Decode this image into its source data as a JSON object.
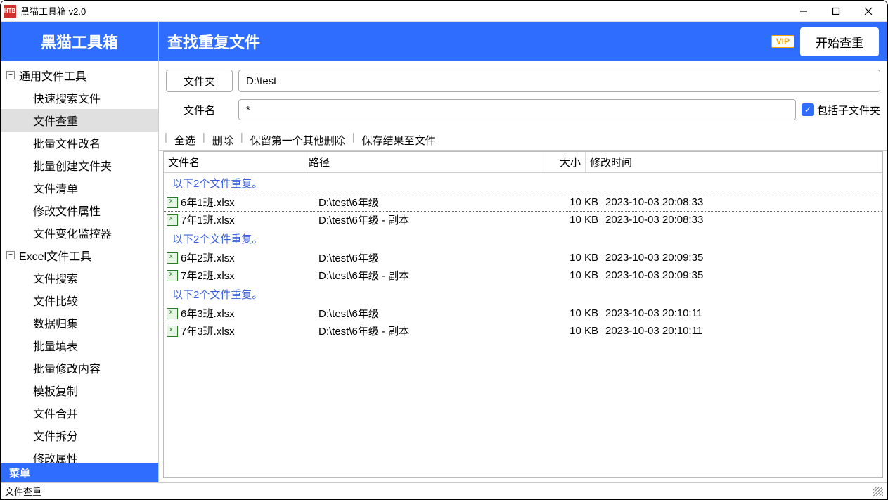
{
  "window": {
    "title": "黑猫工具箱 v2.0",
    "logo_text": "HTB"
  },
  "sidebar": {
    "brand": "黑猫工具箱",
    "footer": "菜单",
    "groups": [
      {
        "label": "通用文件工具",
        "expanded": true,
        "items": [
          "快速搜索文件",
          "文件查重",
          "批量文件改名",
          "批量创建文件夹",
          "文件清单",
          "修改文件属性",
          "文件变化监控器"
        ]
      },
      {
        "label": "Excel文件工具",
        "expanded": true,
        "items": [
          "文件搜索",
          "文件比较",
          "数据归集",
          "批量填表",
          "批量修改内容",
          "模板复制",
          "文件合并",
          "文件拆分",
          "修改属性"
        ]
      }
    ],
    "active_item": "文件查重"
  },
  "header": {
    "title": "查找重复文件",
    "vip": "VIP",
    "start": "开始查重"
  },
  "form": {
    "folder_btn": "文件夹",
    "folder_value": "D:\\test",
    "filename_label": "文件名",
    "pattern_value": "*",
    "include_sub_label": "包括子文件夹",
    "include_sub_checked": true
  },
  "toolbar": {
    "select_all": "全选",
    "delete": "删除",
    "keep_first": "保留第一个其他删除",
    "save_result": "保存结果至文件"
  },
  "columns": {
    "name": "文件名",
    "path": "路径",
    "size": "大小",
    "date": "修改时间"
  },
  "group_prefix": "以下2个文件重复。",
  "groups": [
    {
      "files": [
        {
          "name": "6年1班.xlsx",
          "path": "D:\\test\\6年级",
          "size": "10 KB",
          "date": "2023-10-03 20:08:33",
          "selected": true
        },
        {
          "name": "7年1班.xlsx",
          "path": "D:\\test\\6年级 - 副本",
          "size": "10 KB",
          "date": "2023-10-03 20:08:33"
        }
      ]
    },
    {
      "files": [
        {
          "name": "6年2班.xlsx",
          "path": "D:\\test\\6年级",
          "size": "10 KB",
          "date": "2023-10-03 20:09:35"
        },
        {
          "name": "7年2班.xlsx",
          "path": "D:\\test\\6年级 - 副本",
          "size": "10 KB",
          "date": "2023-10-03 20:09:35"
        }
      ]
    },
    {
      "files": [
        {
          "name": "6年3班.xlsx",
          "path": "D:\\test\\6年级",
          "size": "10 KB",
          "date": "2023-10-03 20:10:11"
        },
        {
          "name": "7年3班.xlsx",
          "path": "D:\\test\\6年级 - 副本",
          "size": "10 KB",
          "date": "2023-10-03 20:10:11"
        }
      ]
    }
  ],
  "status": {
    "text": "文件查重"
  }
}
